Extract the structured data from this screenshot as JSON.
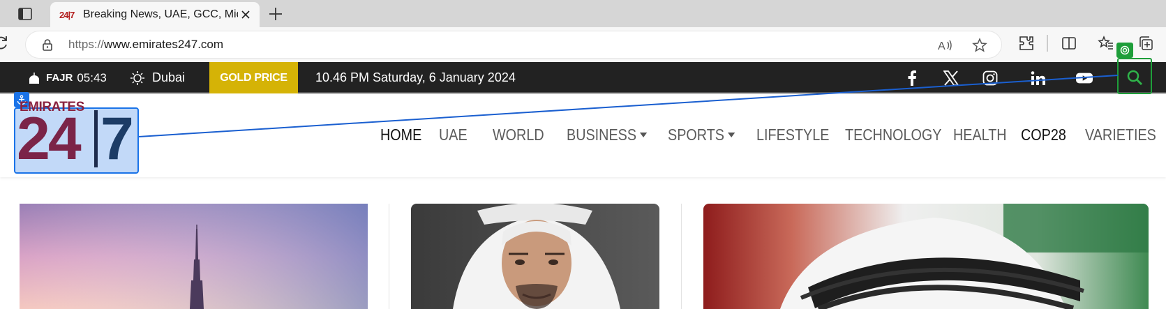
{
  "browser": {
    "tab_title": "Breaking News, UAE, GCC, Middle East",
    "favicon_text": "24|7",
    "url_protocol": "https://",
    "url_host": "www.emirates247.com"
  },
  "topbar": {
    "prayer_name": "FAJR",
    "prayer_time": "05:43",
    "city": "Dubai",
    "gold_label": "GOLD PRICE",
    "datetime": "10.46 PM Saturday, 6 January 2024",
    "social": [
      "facebook-icon",
      "x-icon",
      "instagram-icon",
      "linkedin-icon",
      "youtube-icon"
    ],
    "accent": "#d5b306",
    "background": "#222222"
  },
  "logo": {
    "word": "EMIRATES",
    "number": "24",
    "seven": "7"
  },
  "nav": {
    "items": [
      {
        "label": "HOME"
      },
      {
        "label": "UAE"
      },
      {
        "label": "WORLD"
      },
      {
        "label": "BUSINESS"
      },
      {
        "label": "SPORTS"
      },
      {
        "label": "LIFESTYLE"
      },
      {
        "label": "TECHNOLOGY"
      },
      {
        "label": "HEALTH"
      },
      {
        "label": "COP28"
      },
      {
        "label": "VARIETIES"
      }
    ]
  }
}
